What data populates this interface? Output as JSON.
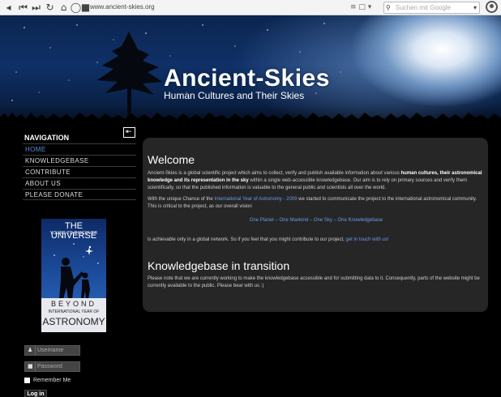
{
  "browser": {
    "url": "www.ancient-skies.org",
    "search_placeholder": "Suchen mit Google"
  },
  "header": {
    "title": "Ancient-Skies",
    "subtitle": "Human Cultures and Their Skies"
  },
  "navigation": {
    "title": "NAVIGATION",
    "items": [
      {
        "label": "HOME"
      },
      {
        "label": "KNOWLEDGEBASE"
      },
      {
        "label": "CONTRIBUTE"
      },
      {
        "label": "ABOUT US"
      },
      {
        "label": "PLEASE DONATE"
      }
    ]
  },
  "banner": {
    "line1": "THE UNIVERSE",
    "line2": "YOURS TO DISCOVER",
    "line3": "BEYOND",
    "line4": "INTERNATIONAL YEAR OF",
    "line5": "ASTRONOMY"
  },
  "login": {
    "username_placeholder": "Username",
    "password_placeholder": "Password",
    "remember_label": "Remember Me",
    "login_label": "Log in"
  },
  "content": {
    "welcome_heading": "Welcome",
    "p1_a": "Ancient-Skies is a global scientific project which aims to collect, verify and publish available information about various ",
    "p1_b": "human cultures, their astronomical knowledge and its representation in the sky",
    "p1_c": " within a single web-accessible knowledgebase. Our aim is to rely on primary sources and verify them scientifically, so that the published information is valuable to the general public and scientists all over the world.",
    "p2_a": "With the unique Chance of the ",
    "p2_link": "International Year of Astronomy - 2009",
    "p2_b": " we started to communicate the project to the international astronomical community. This is critical to the project, as our overall vision",
    "vision": "One Planet – One Mankind – One Sky – One Knowledgebase",
    "p3_a": "is achievable only in a global network. So if you feel that you might contribute to our project, ",
    "p3_link": "get in touch with us!",
    "kb_heading": "Knowledgebase in transition",
    "p4": "Please note that we are currently working to make the knowledgebase accessible and for submitting data to it. Consequently, parts of the website might be currently available to the public. Please bear with us :)"
  },
  "colors": {
    "link": "#6a9ae8",
    "panel": "#262626",
    "active_nav": "#5b8fe0"
  }
}
